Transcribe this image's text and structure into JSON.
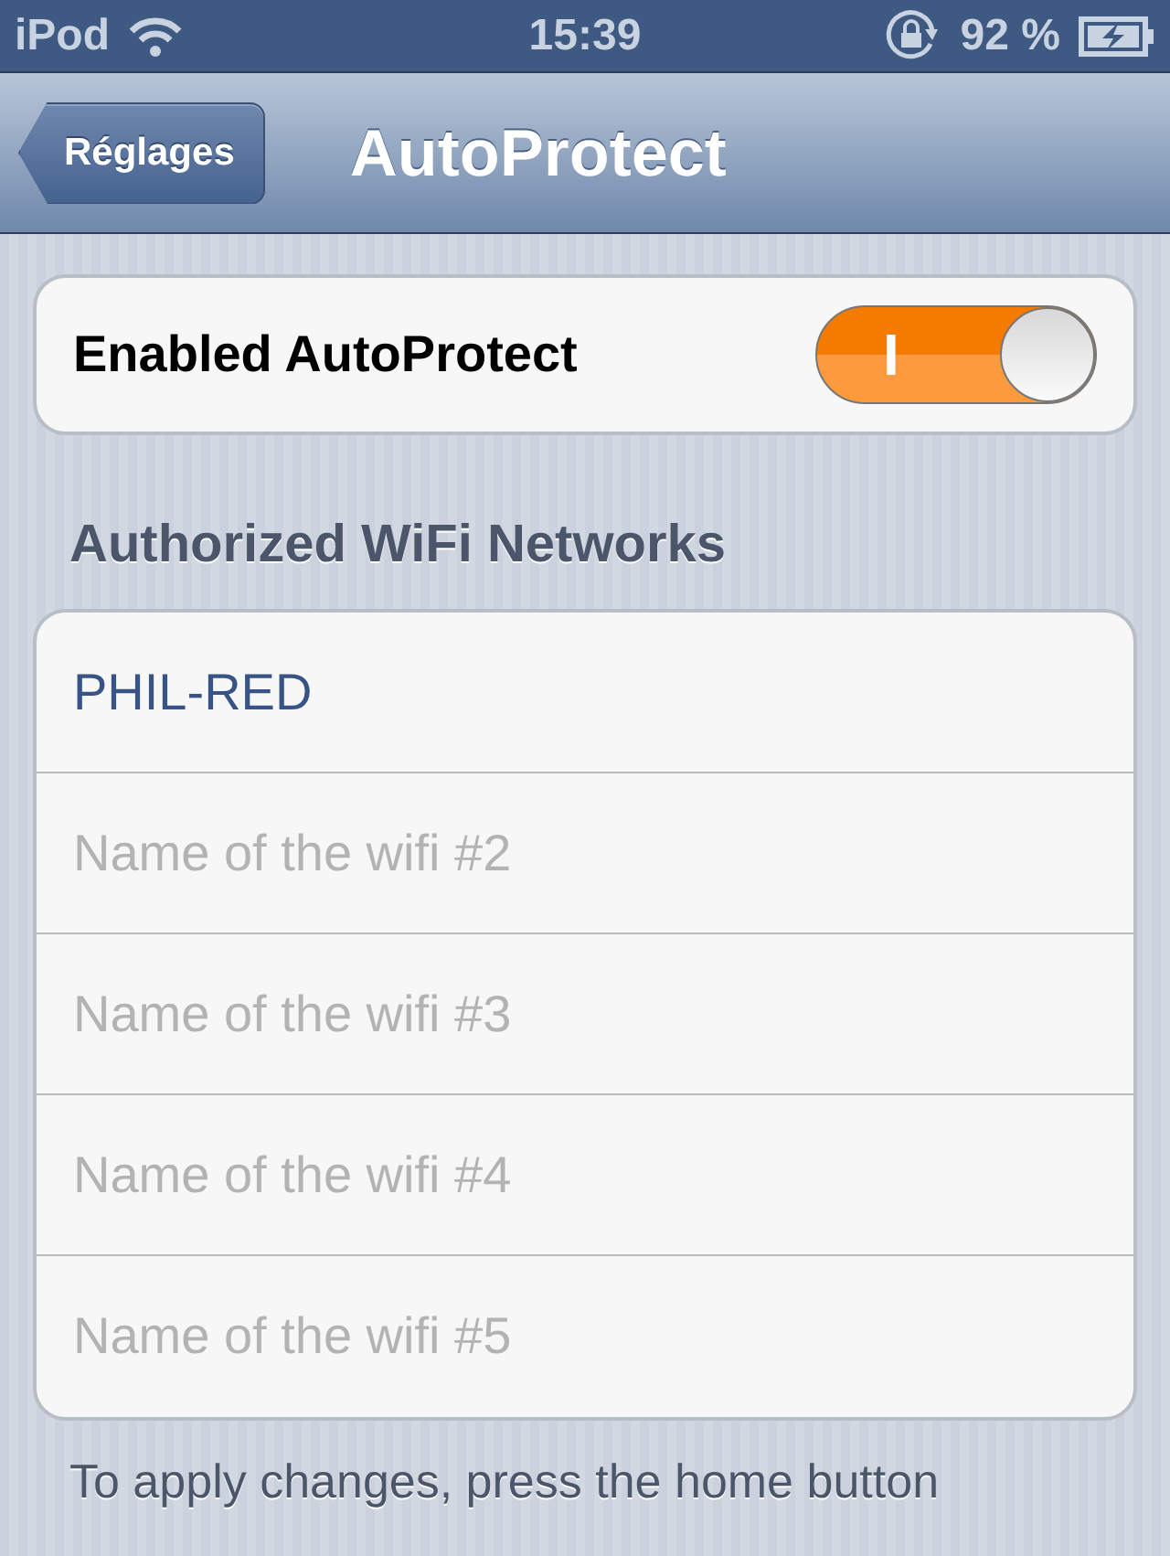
{
  "status_bar": {
    "carrier": "iPod",
    "time": "15:39",
    "battery": "92 %"
  },
  "nav_bar": {
    "back_button": "Réglages",
    "title": "AutoProtect"
  },
  "toggle_row": {
    "label": "Enabled AutoProtect",
    "on": true,
    "on_label": "I"
  },
  "section_header": "Authorized WiFi Networks",
  "networks": [
    {
      "value": "PHIL-RED"
    },
    {
      "placeholder": "Name of the wifi #2"
    },
    {
      "placeholder": "Name of the wifi #3"
    },
    {
      "placeholder": "Name of the wifi #4"
    },
    {
      "placeholder": "Name of the wifi #5"
    }
  ],
  "footer": "To apply changes, press the home button"
}
